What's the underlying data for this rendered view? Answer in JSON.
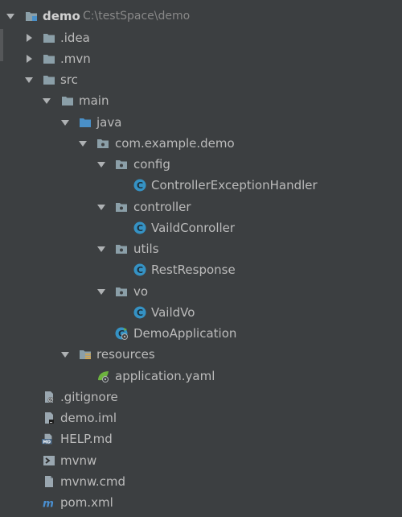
{
  "colors": {
    "background": "#3c3f41",
    "text": "#bbbbbb",
    "path_text": "#888888",
    "folder": "#8b9fa8",
    "source_folder": "#4a90c8",
    "class_icon": "#3592c4",
    "arrow": "#aeb1b3"
  },
  "tree": [
    {
      "label": "demo",
      "path": "C:\\testSpace\\demo",
      "icon": "module-folder-icon",
      "expanded": true
    },
    {
      "label": ".idea",
      "icon": "folder-icon",
      "expanded": false
    },
    {
      "label": ".mvn",
      "icon": "folder-icon",
      "expanded": false
    },
    {
      "label": "src",
      "icon": "folder-icon",
      "expanded": true
    },
    {
      "label": "main",
      "icon": "folder-icon",
      "expanded": true
    },
    {
      "label": "java",
      "icon": "source-folder-icon",
      "expanded": true
    },
    {
      "label": "com.example.demo",
      "icon": "package-icon",
      "expanded": true
    },
    {
      "label": "config",
      "icon": "package-icon",
      "expanded": true
    },
    {
      "label": "ControllerExceptionHandler",
      "icon": "class-icon"
    },
    {
      "label": "controller",
      "icon": "package-icon",
      "expanded": true
    },
    {
      "label": "VaildConroller",
      "icon": "class-icon"
    },
    {
      "label": "utils",
      "icon": "package-icon",
      "expanded": true
    },
    {
      "label": "RestResponse",
      "icon": "class-icon"
    },
    {
      "label": "vo",
      "icon": "package-icon",
      "expanded": true
    },
    {
      "label": "VaildVo",
      "icon": "class-icon"
    },
    {
      "label": "DemoApplication",
      "icon": "spring-boot-class-icon"
    },
    {
      "label": "resources",
      "icon": "resources-folder-icon",
      "expanded": true
    },
    {
      "label": "application.yaml",
      "icon": "spring-yaml-icon"
    },
    {
      "label": ".gitignore",
      "icon": "ignored-file-icon"
    },
    {
      "label": "demo.iml",
      "icon": "iml-file-icon"
    },
    {
      "label": "HELP.md",
      "icon": "markdown-file-icon"
    },
    {
      "label": "mvnw",
      "icon": "shell-file-icon"
    },
    {
      "label": "mvnw.cmd",
      "icon": "text-file-icon"
    },
    {
      "label": "pom.xml",
      "icon": "maven-pom-icon"
    }
  ]
}
